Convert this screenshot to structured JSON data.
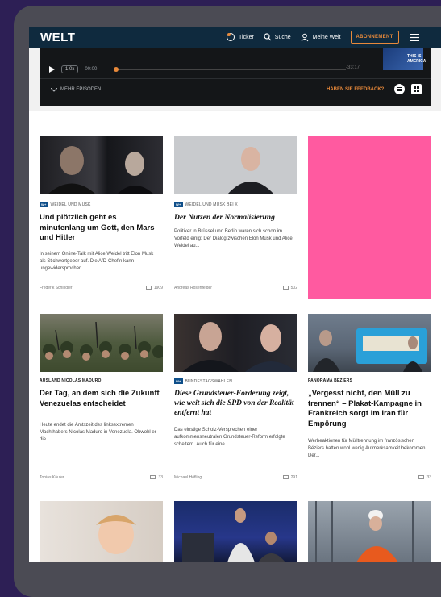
{
  "header": {
    "logo": "WELT",
    "nav": {
      "ticker": "Ticker",
      "search": "Suche",
      "my_welt": "Meine Welt",
      "subscribe": "ABONNEMENT"
    }
  },
  "player": {
    "speed": "1.0x",
    "elapsed": "00:00",
    "duration": "-33:17",
    "episodes_label": "MEHR EPISODEN",
    "feedback_label": "HABEN SIE FEEDBACK?",
    "cover_text": "THIS IS AMERICA"
  },
  "articles": [
    {
      "badge": "W+",
      "section": "WEIDEL UND MUSK",
      "headline": "Und plötzlich geht es minutenlang um Gott, den Mars und Hitler",
      "teaser": "In seinem Online-Talk mit Alice Weidel tritt Elon Musk als Stichwortgeber auf. Die AfD-Chefin kann ungewidersprochen...",
      "author": "Frederik Schindler",
      "comments": "1909"
    },
    {
      "badge": "W+",
      "section": "WEIDEL UND MUSK BEI X",
      "headline": "Der Nutzen der Normalisierung",
      "teaser": "Politiker in Brüssel und Berlin waren sich schon im Vorfeld einig: Der Dialog zwischen Elon Musk und Alice Weidel au...",
      "author": "Andreas Rosenfelder",
      "comments": "502"
    },
    {
      "badge": "",
      "section": "AUSLAND  NICOLÁS MADURO",
      "headline": "Der Tag, an dem sich die Zukunft Venezuelas entscheidet",
      "teaser": "Heute endet die Amtszeit des linksextremen Machthabers Nicolás Maduro in Venezuela. Obwohl er die...",
      "author": "Tobias Käufer",
      "comments": "33"
    },
    {
      "badge": "W+",
      "section": "BUNDESTAGSWAHLEN",
      "headline": "Diese Grundsteuer-Forderung zeigt, wie weit sich die SPD von der Realität entfernt hat",
      "teaser": "Das einstige Scholz-Versprechen einer aufkommensneutralen Grundsteuer-Reform erfolgte scheitern. Auch für eine...",
      "author": "Michael Höfling",
      "comments": "291"
    },
    {
      "badge": "",
      "section": "PANORAMA  BEZIERS",
      "headline": "„Vergesst nicht, den Müll zu trennen“ – Plakat-Kampagne in Frankreich sorgt im Iran für Empörung",
      "teaser": "Werbeaktionen für Mülltrennung im französischen Béziers hatten wohl wenig Aufmerksamkeit bekommen. Der...",
      "author": "",
      "comments": "33"
    }
  ]
}
